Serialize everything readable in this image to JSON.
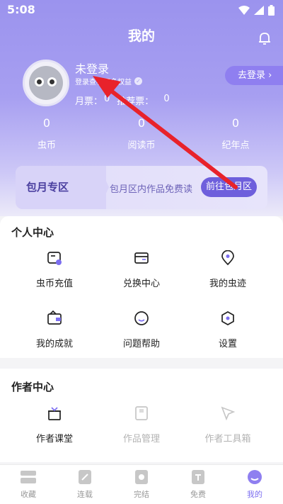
{
  "status_bar": {
    "time": "5:08"
  },
  "header": {
    "title": "我的"
  },
  "profile": {
    "login_title": "未登录",
    "login_subtitle": "登录查看更多权益",
    "monthly_ticket_label": "月票：",
    "monthly_ticket_value": "0",
    "recommend_ticket_label": "推荐票：",
    "recommend_ticket_value": "0",
    "go_login_label": "去登录"
  },
  "stats": [
    {
      "value": "0",
      "label": "虫币"
    },
    {
      "value": "0",
      "label": "阅读币"
    },
    {
      "value": "0",
      "label": "纪年点"
    }
  ],
  "monthly_zone": {
    "title": "包月专区",
    "text": "包月区内作品免费读",
    "button": "前往包月区"
  },
  "personal_center": {
    "title": "个人中心",
    "items": [
      {
        "label": "虫币充值",
        "icon": "wallet-icon"
      },
      {
        "label": "兑换中心",
        "icon": "card-icon"
      },
      {
        "label": "我的虫迹",
        "icon": "location-pin-icon"
      },
      {
        "label": "我的成就",
        "icon": "achievement-icon"
      },
      {
        "label": "问题帮助",
        "icon": "smile-icon"
      },
      {
        "label": "设置",
        "icon": "settings-icon"
      }
    ]
  },
  "author_center": {
    "title": "作者中心",
    "items": [
      {
        "label": "作者课堂",
        "icon": "gift-box-icon"
      },
      {
        "label": "作品管理",
        "icon": "book-icon"
      },
      {
        "label": "作者工具箱",
        "icon": "cursor-icon"
      }
    ]
  },
  "tabbar": {
    "items": [
      {
        "label": "收藏",
        "icon": "bookshelf-icon"
      },
      {
        "label": "连载",
        "icon": "serial-icon"
      },
      {
        "label": "完结",
        "icon": "finished-icon"
      },
      {
        "label": "免费",
        "icon": "free-icon"
      },
      {
        "label": "我的",
        "icon": "me-icon"
      }
    ],
    "active_index": 4
  },
  "colors": {
    "accent": "#7c6ef0",
    "header": "#9b93ee",
    "annotation_arrow": "#e8222b"
  }
}
